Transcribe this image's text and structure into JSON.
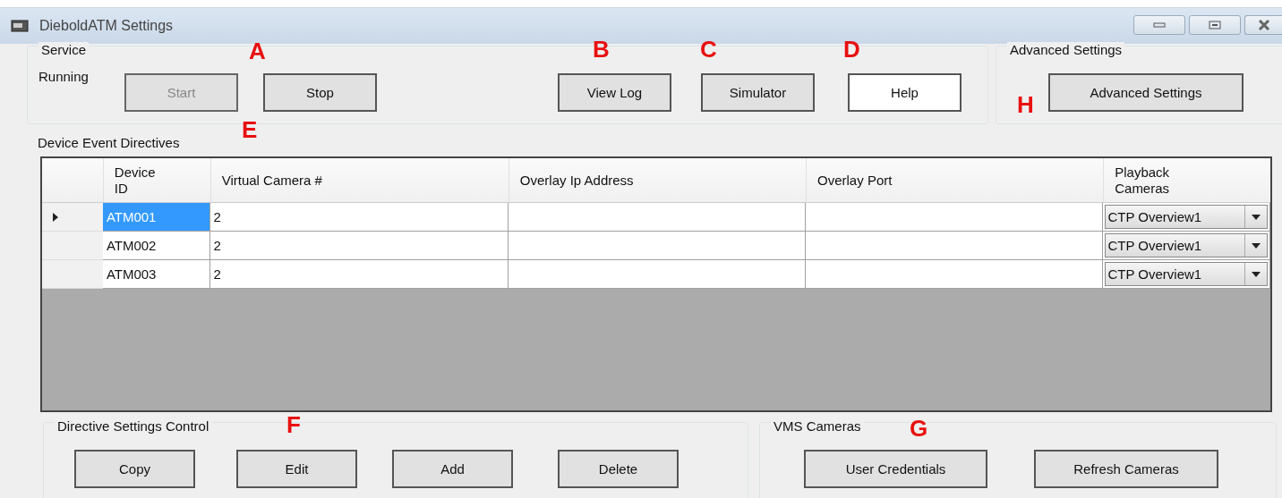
{
  "window": {
    "title": "DieboldATM Settings"
  },
  "service": {
    "title": "Service",
    "status": "Running",
    "buttons": [
      {
        "label": "Start",
        "disabled": true,
        "highlighted": false
      },
      {
        "label": "Stop",
        "disabled": false,
        "highlighted": false
      },
      {
        "label": "View Log",
        "disabled": false,
        "highlighted": false
      },
      {
        "label": "Simulator",
        "disabled": false,
        "highlighted": false
      },
      {
        "label": "Help",
        "disabled": false,
        "highlighted": true
      }
    ]
  },
  "advanced": {
    "title": "Advanced Settings",
    "button": "Advanced Settings"
  },
  "directives": {
    "title": "Device Event Directives",
    "columns": [
      "Device ID",
      "Virtual Camera #",
      "Overlay Ip Address",
      "Overlay Port",
      "Playback Cameras"
    ],
    "rows": [
      {
        "device_id": "ATM001",
        "virtual_camera": "2",
        "playback_camera": "CTP Overview1",
        "selected": true
      },
      {
        "device_id": "ATM002",
        "virtual_camera": "2",
        "playback_camera": "CTP Overview1",
        "selected": false
      },
      {
        "device_id": "ATM003",
        "virtual_camera": "2",
        "playback_camera": "CTP Overview1",
        "selected": false
      }
    ]
  },
  "directive_control": {
    "title": "Directive Settings Control",
    "buttons": [
      "Copy",
      "Edit",
      "Add",
      "Delete"
    ]
  },
  "vms_cameras": {
    "title": "VMS Cameras",
    "buttons": [
      "User Credentials",
      "Refresh Cameras"
    ]
  },
  "annotations": [
    "A",
    "B",
    "C",
    "D",
    "E",
    "F",
    "G",
    "H"
  ]
}
